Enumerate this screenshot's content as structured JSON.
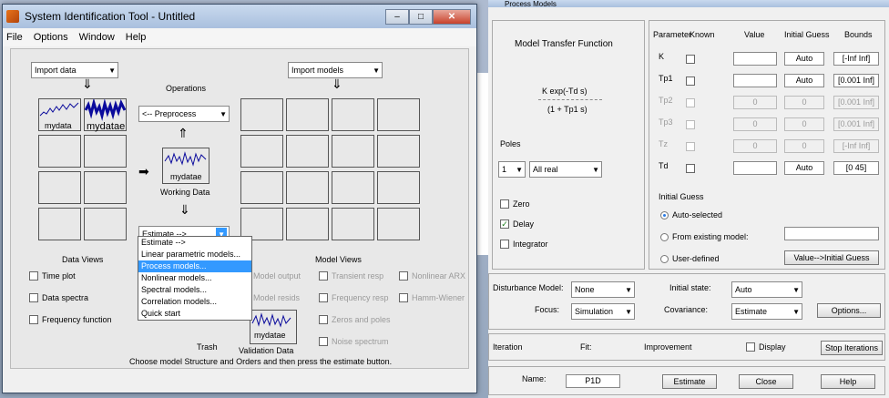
{
  "w1": {
    "title": "System Identification Tool - Untitled",
    "menu": [
      "File",
      "Options",
      "Window",
      "Help"
    ],
    "import_data": "Import data",
    "import_models": "Import models",
    "operations": "Operations",
    "preprocess": "<-- Preprocess",
    "working_data": "Working Data",
    "data1": "mydata",
    "data2": "mydatae",
    "wdata": "mydatae",
    "estimate": "Estimate -->",
    "data_views": "Data Views",
    "model_views": "Model Views",
    "time_plot": "Time plot",
    "data_spectra": "Data spectra",
    "freq_function": "Frequency function",
    "model_output": "Model output",
    "model_resids": "Model resids",
    "transient": "Transient resp",
    "freq_resp": "Frequency resp",
    "zeros_poles": "Zeros and poles",
    "noise": "Noise spectrum",
    "nonlin_arx": "Nonlinear ARX",
    "hammer": "Hamm-Wiener",
    "trash": "Trash",
    "validation": "Validation Data",
    "vdata": "mydatae",
    "hint": "Choose model Structure and Orders and then press the estimate button.",
    "estimate_menu": [
      "Estimate -->",
      "Linear parametric models...",
      "Process models...",
      "Nonlinear models...",
      "Spectral models...",
      "Correlation models...",
      "Quick start"
    ]
  },
  "w2": {
    "title": "Process Models",
    "mtf": "Model Transfer Function",
    "formula_num": "K exp(-Td s)",
    "formula_den": "(1 + Tp1 s)",
    "poles": "Poles",
    "poles_n": "1",
    "poles_type": "All real",
    "zero": "Zero",
    "delay": "Delay",
    "integrator": "Integrator",
    "hdr": [
      "Parameter",
      "Known",
      "Value",
      "Initial Guess",
      "Bounds"
    ],
    "params": [
      {
        "name": "K",
        "value": "",
        "guess": "Auto",
        "bounds": "[-Inf Inf]",
        "enabled": true
      },
      {
        "name": "Tp1",
        "value": "",
        "guess": "Auto",
        "bounds": "[0.001 Inf]",
        "enabled": true
      },
      {
        "name": "Tp2",
        "value": "0",
        "guess": "0",
        "bounds": "[0.001 Inf]",
        "enabled": false
      },
      {
        "name": "Tp3",
        "value": "0",
        "guess": "0",
        "bounds": "[0.001 Inf]",
        "enabled": false
      },
      {
        "name": "Tz",
        "value": "0",
        "guess": "0",
        "bounds": "[-Inf Inf]",
        "enabled": false
      },
      {
        "name": "Td",
        "value": "",
        "guess": "Auto",
        "bounds": "[0 45]",
        "enabled": true
      }
    ],
    "initial_guess": "Initial Guess",
    "auto_sel": "Auto-selected",
    "from_existing": "From existing model:",
    "user_def": "User-defined",
    "value_initial": "Value-->Initial Guess",
    "dist_model": "Disturbance Model:",
    "dist_val": "None",
    "initial_state": "Initial state:",
    "initial_state_val": "Auto",
    "focus": "Focus:",
    "focus_val": "Simulation",
    "covariance": "Covariance:",
    "covariance_val": "Estimate",
    "options": "Options...",
    "iteration": "Iteration",
    "fit": "Fit:",
    "improvement": "Improvement",
    "display": "Display",
    "stop": "Stop Iterations",
    "name_lbl": "Name:",
    "name_val": "P1D",
    "estimate_btn": "Estimate",
    "close_btn": "Close",
    "help_btn": "Help"
  }
}
